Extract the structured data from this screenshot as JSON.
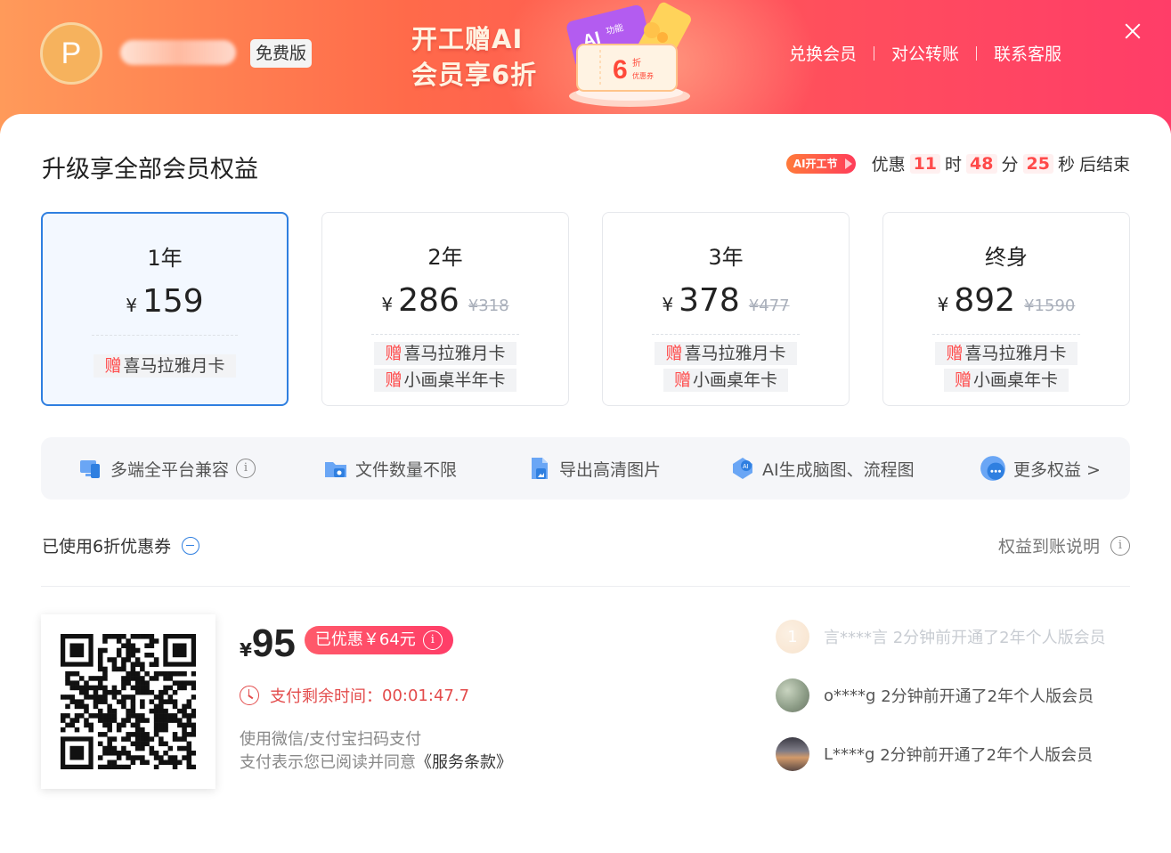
{
  "header": {
    "avatar_letter": "P",
    "plan_badge": "免费版",
    "promo_line1": "开工赠AI",
    "promo_line2": "会员享6折",
    "coupon_art": {
      "ticket_label": "AI",
      "ticket_text": "功能",
      "discount_num": "6",
      "discount_unit": "折",
      "discount_caption": "优惠券"
    },
    "links": [
      "兑换会员",
      "对公转账",
      "联系客服"
    ]
  },
  "main": {
    "title": "升级享全部会员权益",
    "event_tag": "AI开工节",
    "countdown": {
      "prefix": "优惠",
      "hours": "11",
      "hours_unit": "时",
      "minutes": "48",
      "minutes_unit": "分",
      "seconds": "25",
      "seconds_unit": "秒",
      "suffix": "后结束"
    },
    "plans": [
      {
        "name": "1年",
        "currency": "¥",
        "price": "159",
        "original": "",
        "gift_mark": "赠",
        "gifts": [
          "喜马拉雅月卡"
        ],
        "selected": true
      },
      {
        "name": "2年",
        "currency": "¥",
        "price": "286",
        "original": "¥318",
        "gift_mark": "赠",
        "gifts": [
          "喜马拉雅月卡",
          "小画桌半年卡"
        ],
        "selected": false
      },
      {
        "name": "3年",
        "currency": "¥",
        "price": "378",
        "original": "¥477",
        "gift_mark": "赠",
        "gifts": [
          "喜马拉雅月卡",
          "小画桌年卡"
        ],
        "selected": false
      },
      {
        "name": "终身",
        "currency": "¥",
        "price": "892",
        "original": "¥1590",
        "gift_mark": "赠",
        "gifts": [
          "喜马拉雅月卡",
          "小画桌年卡"
        ],
        "selected": false
      }
    ],
    "benefits": [
      {
        "label": "多端全平台兼容",
        "icon": "devices-icon",
        "info": "i"
      },
      {
        "label": "文件数量不限",
        "icon": "folder-icon"
      },
      {
        "label": "导出高清图片",
        "icon": "image-file-icon"
      },
      {
        "label": "AI生成脑图、流程图",
        "icon": "ai-icon"
      },
      {
        "label": "更多权益 >",
        "icon": "more-icon"
      }
    ],
    "coupon_used": "已使用6折优惠券",
    "rights_note": "权益到账说明",
    "info_glyph": "i"
  },
  "payment": {
    "currency": "¥",
    "amount": "95",
    "discount_pill": "已优惠￥64元",
    "timer_label": "支付剩余时间：",
    "timer_value": "00:01:47.7",
    "tip_line1": "使用微信/支付宝扫码支付",
    "tip_line2_prefix": "支付表示您已阅读并同意",
    "terms_link": "《服务条款》"
  },
  "feed": [
    {
      "user": "言****言",
      "text": "2分钟前开通了2年个人版会员",
      "avatar_letter": "1",
      "faded": true
    },
    {
      "user": "o****g",
      "text": "2分钟前开通了2年个人版会员",
      "avatar_letter": "",
      "faded": false
    },
    {
      "user": "L****g",
      "text": "2分钟前开通了2年个人版会员",
      "avatar_letter": "",
      "faded": false
    }
  ],
  "colors": {
    "accent_blue": "#2f7fe0",
    "accent_red": "#ff4a4a",
    "header_gradient_start": "#ff9a5a",
    "header_gradient_end": "#ff3d68"
  }
}
